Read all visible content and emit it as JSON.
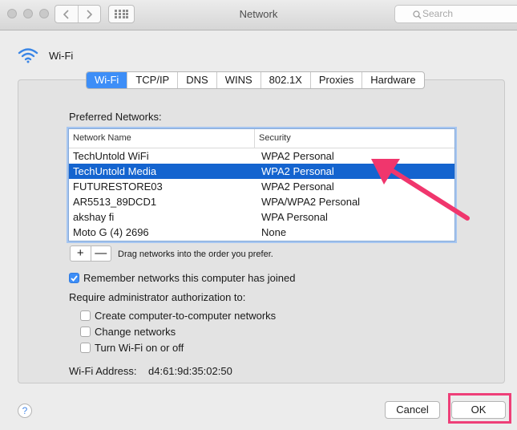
{
  "window": {
    "title": "Network",
    "search_placeholder": "Search"
  },
  "section": {
    "title": "Wi-Fi"
  },
  "tabs": [
    "Wi-Fi",
    "TCP/IP",
    "DNS",
    "WINS",
    "802.1X",
    "Proxies",
    "Hardware"
  ],
  "active_tab": "Wi-Fi",
  "preferred": {
    "label": "Preferred Networks:",
    "columns": [
      "Network Name",
      "Security"
    ],
    "rows": [
      {
        "name": "TechUntold WiFi",
        "security": "WPA2 Personal"
      },
      {
        "name": "TechUntold Media",
        "security": "WPA2 Personal",
        "selected": true
      },
      {
        "name": "FUTURESTORE03",
        "security": "WPA2 Personal"
      },
      {
        "name": "AR5513_89DCD1",
        "security": "WPA/WPA2 Personal"
      },
      {
        "name": "akshay fi",
        "security": "WPA Personal"
      },
      {
        "name": "Moto G (4) 2696",
        "security": "None"
      }
    ],
    "add_label": "+",
    "remove_label": "—",
    "drag_hint": "Drag networks into the order you prefer."
  },
  "remember": {
    "label": "Remember networks this computer has joined",
    "checked": true
  },
  "require_label": "Require administrator authorization to:",
  "admin_options": [
    {
      "label": "Create computer-to-computer networks",
      "checked": false
    },
    {
      "label": "Change networks",
      "checked": false
    },
    {
      "label": "Turn Wi-Fi on or off",
      "checked": false
    }
  ],
  "wifi_address": {
    "label": "Wi-Fi Address:",
    "value": "d4:61:9d:35:02:50"
  },
  "buttons": {
    "help": "?",
    "cancel": "Cancel",
    "ok": "OK"
  },
  "colors": {
    "accent": "#3d8ef7",
    "selection": "#1464cf",
    "highlight": "#ee3f78"
  }
}
